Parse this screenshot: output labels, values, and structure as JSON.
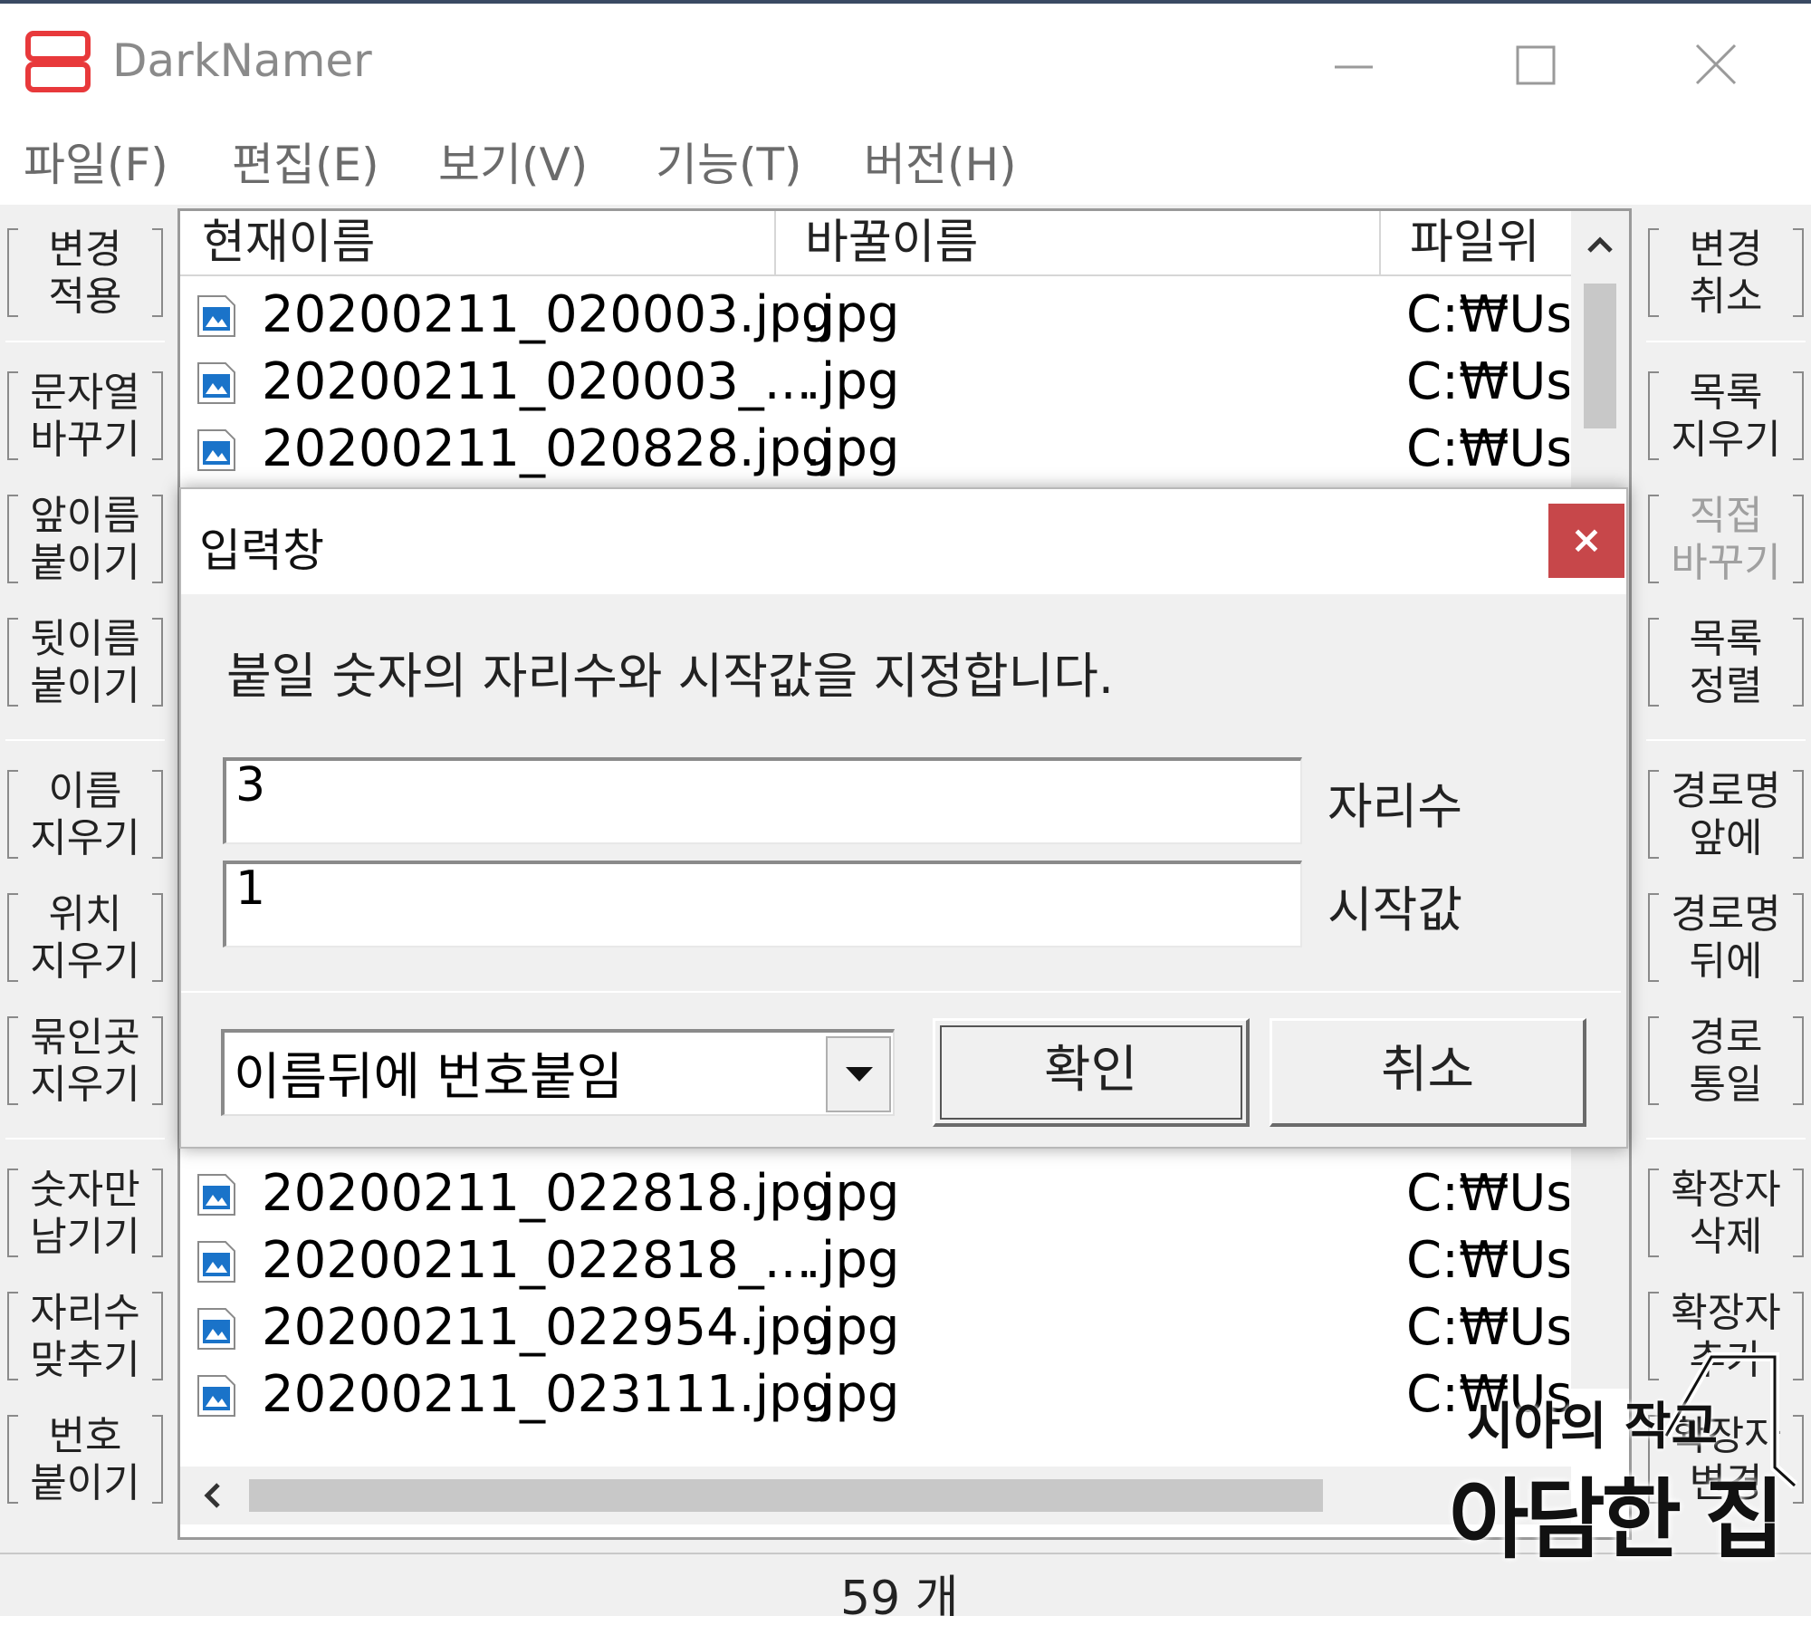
{
  "window": {
    "title": "DarkNamer",
    "menu": [
      "파일(F)",
      "편집(E)",
      "보기(V)",
      "기능(T)",
      "버전(H)"
    ]
  },
  "left_buttons": [
    "변경\n적용",
    "문자열\n바꾸기",
    "앞이름\n붙이기",
    "뒷이름\n붙이기",
    "이름\n지우기",
    "위치\n지우기",
    "묶인곳\n지우기",
    "숫자만\n남기기",
    "자리수\n맞추기",
    "번호\n붙이기"
  ],
  "right_buttons": [
    "변경\n취소",
    "목록\n지우기",
    "직접\n바꾸기",
    "목록\n정렬",
    "경로명\n앞에",
    "경로명\n뒤에",
    "경로\n통일",
    "확장자\n삭제",
    "확장자\n추가",
    "확장자\n변경"
  ],
  "list": {
    "columns": [
      "현재이름",
      "바꿀이름",
      "파일위"
    ],
    "rows_top": [
      {
        "name": "20200211_020003.jpg",
        "new": ".jpg",
        "path": "C:₩Us"
      },
      {
        "name": "20200211_020003_...",
        "new": ".jpg",
        "path": "C:₩Us"
      },
      {
        "name": "20200211_020828.jpg",
        "new": ".jpg",
        "path": "C:₩Us"
      }
    ],
    "rows_bottom": [
      {
        "name": "20200211_022818.jpg",
        "new": ".jpg",
        "path": "C:₩Us"
      },
      {
        "name": "20200211_022818_...",
        "new": ".jpg",
        "path": "C:₩Us"
      },
      {
        "name": "20200211_022954.jpg",
        "new": ".jpg",
        "path": "C:₩Us"
      },
      {
        "name": "20200211_023111.jpg",
        "new": ".jpg",
        "path": "C:₩Us"
      }
    ]
  },
  "status": {
    "count": "59 개"
  },
  "dialog": {
    "title": "입력창",
    "close": "×",
    "message": "붙일 숫자의 자리수와 시작값을 지정합니다.",
    "digits_value": "3",
    "digits_label": "자리수",
    "start_value": "1",
    "start_label": "시작값",
    "mode_selected": "이름뒤에 번호붙임",
    "ok": "확인",
    "cancel": "취소"
  },
  "watermark": {
    "line1": "시아의 작고",
    "line2": "아담한 집"
  },
  "colors": {
    "close_red": "#c7474a",
    "logo_red": "#e8393b",
    "file_icon_blue": "#1a73c9"
  }
}
